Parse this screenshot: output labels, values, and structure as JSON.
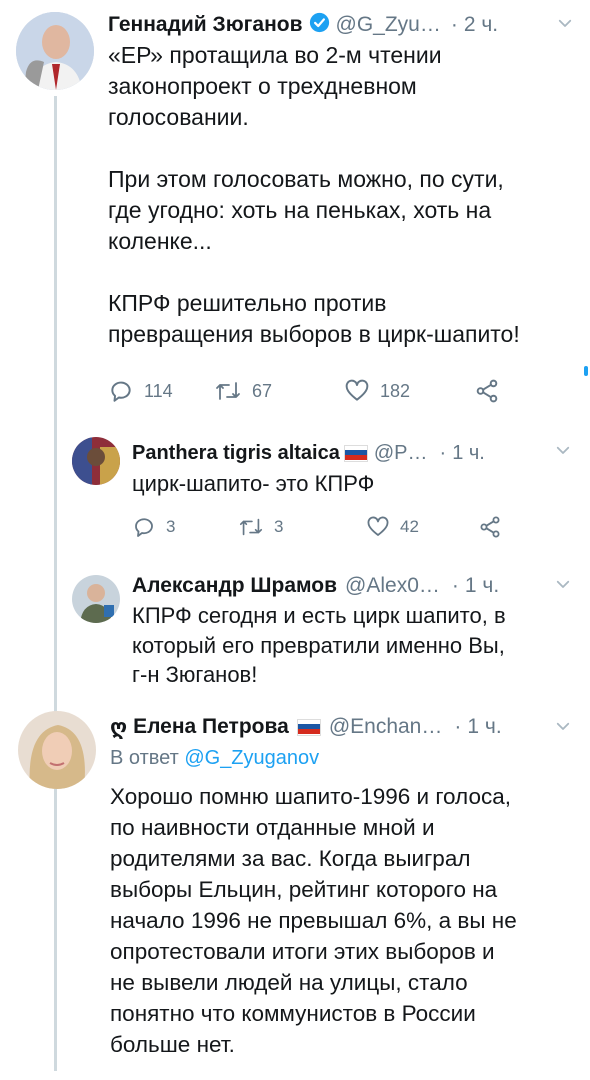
{
  "tweets": [
    {
      "name": "Геннадий Зюганов",
      "handle": "@G_Zyu…",
      "dot": "·",
      "time": "2 ч.",
      "text": "«ЕР» протащила во 2-м чтении\nзаконопроект о трехдневном\nголосовании.\n\nПри этом голосовать можно, по сути,\nгде угодно: хоть на пеньках, хоть на\nколенке...\n\nКПРФ решительно против\nпревращения выборов в цирк-шапито!",
      "replies": "114",
      "retweets": "67",
      "likes": "182"
    },
    {
      "name": "Panthera tigris altaica",
      "handle": "@P…",
      "dot": "·",
      "time": "1 ч.",
      "text": "цирк-шапито- это КПРФ",
      "replies": "3",
      "retweets": "3",
      "likes": "42"
    },
    {
      "name": "Александр Шрамов",
      "handle": "@Alex0…",
      "dot": "·",
      "time": "1 ч.",
      "text": "КПРФ сегодня и есть цирк шапито, в\nкоторый его превратили именно Вы,\nг-н Зюганов!"
    },
    {
      "name": "Елена Петрова",
      "prefix_glyph": "ღ",
      "handle": "@Enchan…",
      "dot": "·",
      "time": "1 ч.",
      "reply_prefix": "В ответ ",
      "reply_handle": "@G_Zyuganov",
      "text": "Хорошо помню шапито-1996 и голоса,\nпо наивности отданные мной и\nродителями за вас. Когда выиграл\nвыборы Ельцин, рейтинг которого на\nначало 1996 не превышал 6%, а вы не\nопротестовали итоги этих выборов и\nне вывели людей на улицы, стало\nпонятно что коммунистов в России\nбольше нет."
    }
  ],
  "icons": {
    "reply": "reply-icon",
    "retweet": "retweet-icon",
    "like": "heart-icon",
    "share": "share-icon",
    "verified": "verified-badge-icon",
    "chevron": "chevron-down-icon",
    "flag": "russia-flag-icon"
  },
  "colors": {
    "text": "#14171a",
    "secondary": "#657786",
    "link": "#1da1f2",
    "verified": "#1da1f2",
    "thread_line": "#cfd9de"
  }
}
